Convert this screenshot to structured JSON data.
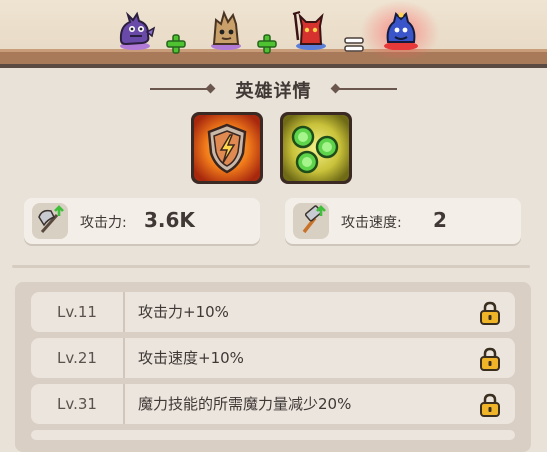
{
  "merge_banner": {
    "heroes": [
      {
        "name": "purple-dragon-hero-icon"
      },
      {
        "name": "tree-stump-hero-icon"
      },
      {
        "name": "red-demon-hero-icon"
      },
      {
        "name": "blue-genie-hero-icon"
      }
    ],
    "operators": [
      "+",
      "+",
      "="
    ]
  },
  "hero_details": {
    "title": "英雄详情",
    "skills": [
      {
        "name": "lightning-shield-skill-icon"
      },
      {
        "name": "green-orbs-skill-icon"
      }
    ],
    "stats": [
      {
        "label": "攻击力:",
        "value": "3.6K",
        "icon": "axe-upgrade-icon"
      },
      {
        "label": "攻击速度:",
        "value": "2",
        "icon": "hammer-upgrade-icon"
      }
    ]
  },
  "levels": [
    {
      "level": "Lv.11",
      "description": "攻击力+10%",
      "locked": true
    },
    {
      "level": "Lv.21",
      "description": "攻击速度+10%",
      "locked": true
    },
    {
      "level": "Lv.31",
      "description": "魔力技能的所需魔力量减少20%",
      "locked": true
    }
  ],
  "colors": {
    "background": "#e9e2d8",
    "text": "#3f3835",
    "plus_green": "#4fc232",
    "lock_gold": "#f0b429"
  }
}
